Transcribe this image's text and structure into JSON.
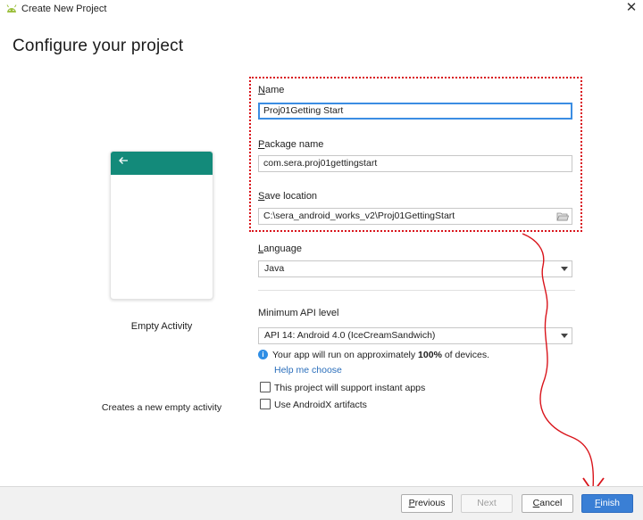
{
  "window": {
    "title": "Create New Project",
    "close_glyph": "✕"
  },
  "page": {
    "title": "Configure your project"
  },
  "template": {
    "name": "Empty Activity",
    "description": "Creates a new empty activity",
    "back_glyph": "←"
  },
  "form": {
    "name": {
      "label_u": "N",
      "label_rest": "ame",
      "value": "Proj01Getting Start"
    },
    "package": {
      "label_u": "P",
      "label_rest": "ackage name",
      "value": "com.sera.proj01gettingstart"
    },
    "save_location": {
      "label_u": "S",
      "label_rest": "ave location",
      "value": "C:\\sera_android_works_v2\\Proj01GettingStart"
    },
    "language": {
      "label_u": "L",
      "label_rest": "anguage",
      "value": "Java"
    },
    "min_api": {
      "label": "Minimum API level",
      "value": "API 14: Android 4.0 (IceCreamSandwich)"
    },
    "info": {
      "glyph": "i",
      "text_before": "Your app will run on approximately ",
      "text_bold": "100%",
      "text_after": " of devices."
    },
    "help_link": "Help me choose",
    "instant_apps": {
      "label": "This project will support instant apps",
      "checked": false
    },
    "androidx": {
      "label": "Use AndroidX artifacts",
      "checked": false
    }
  },
  "buttons": {
    "previous": {
      "u": "P",
      "rest": "revious"
    },
    "next": "Next",
    "cancel": {
      "u": "C",
      "rest": "ancel"
    },
    "finish": {
      "u": "F",
      "rest": "inish"
    }
  },
  "colors": {
    "accent": "#3a7fd5",
    "annotation": "#d9141b",
    "template_bar": "#138a7a"
  }
}
